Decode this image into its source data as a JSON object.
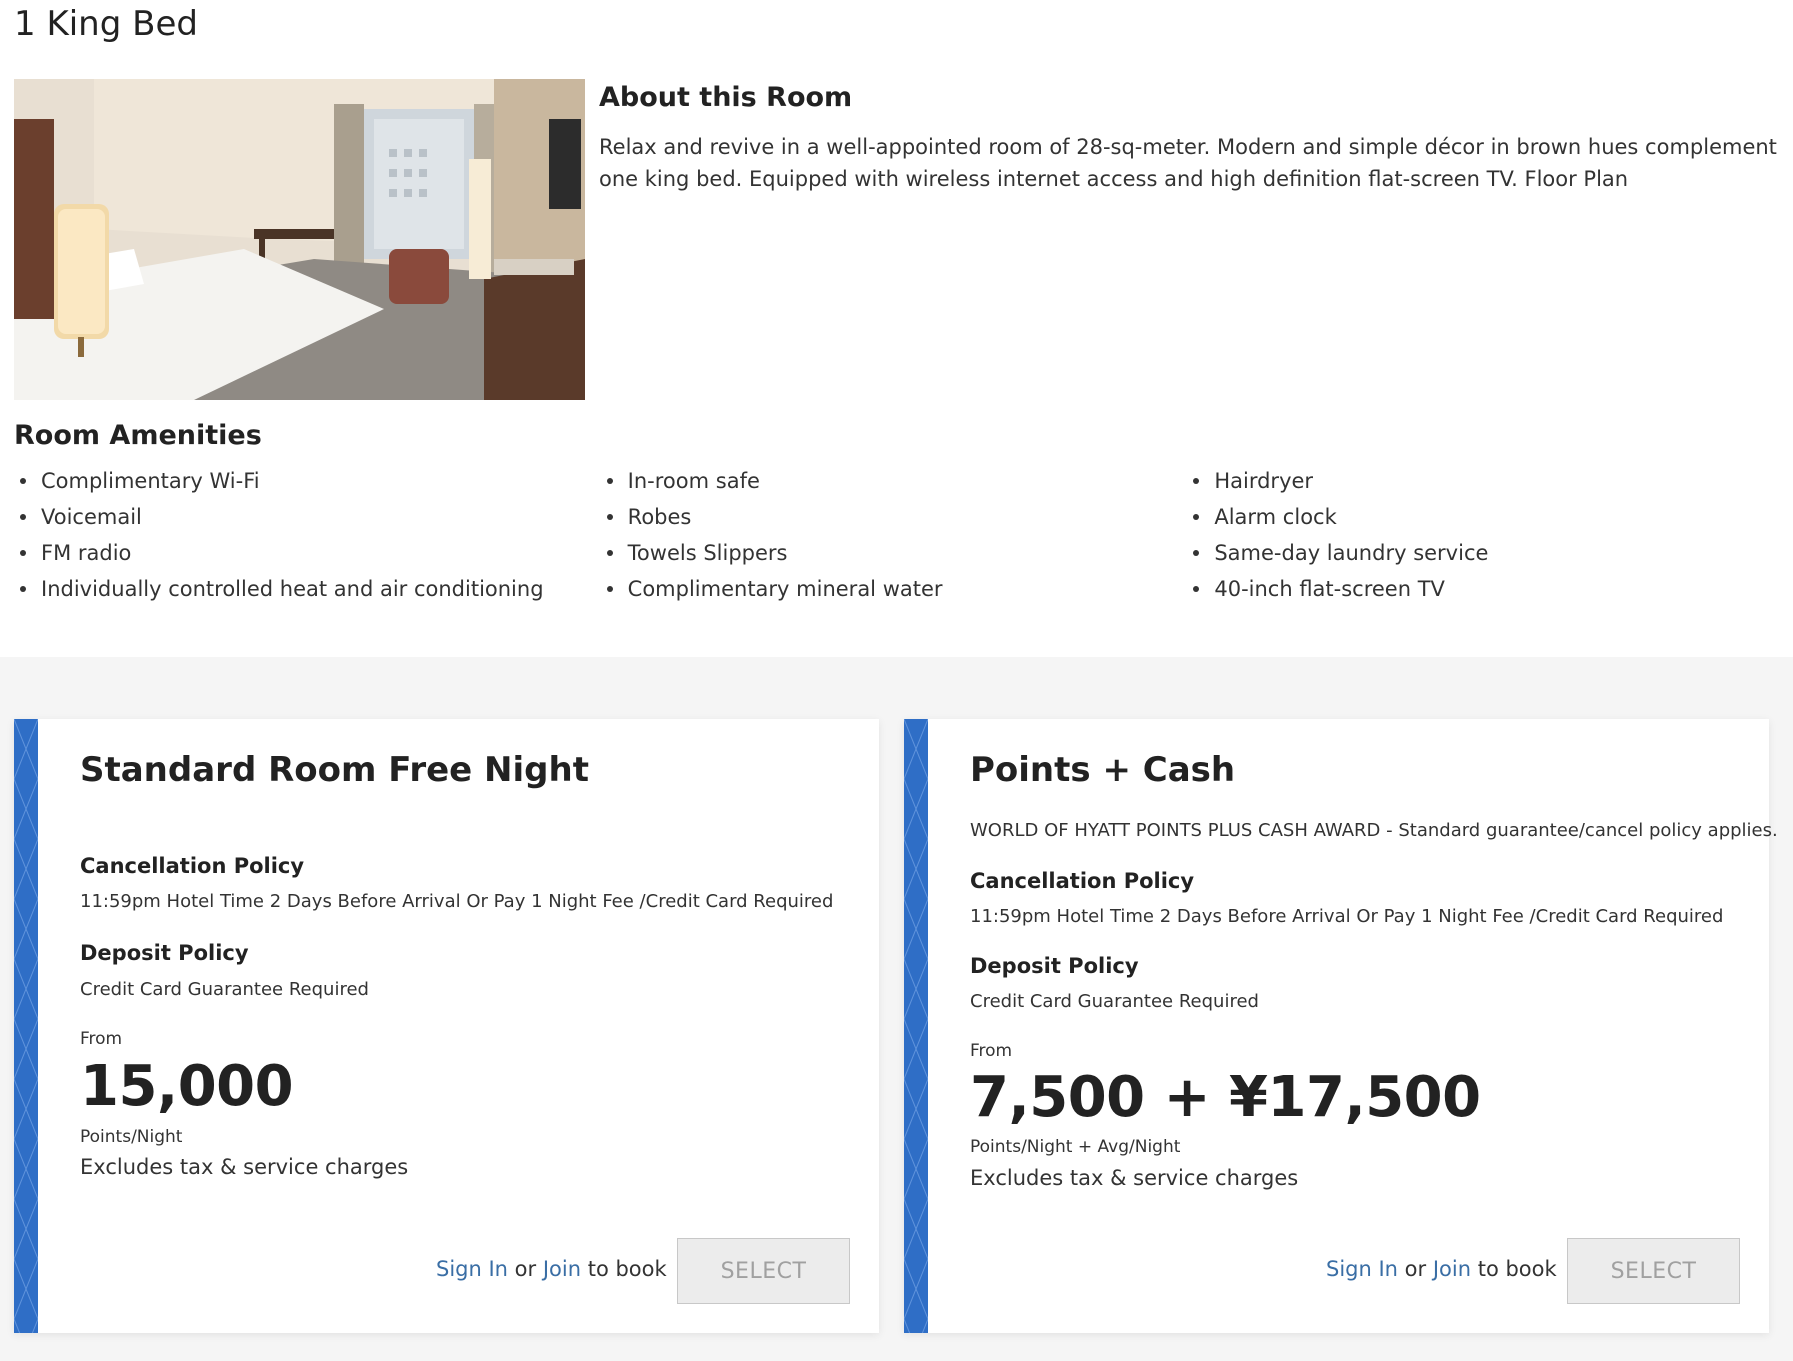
{
  "room": {
    "title": "1 King Bed"
  },
  "about": {
    "heading": "About this Room",
    "text": "Relax and revive in a well-appointed room of 28-sq-meter. Modern and simple décor in brown hues complement one king bed. Equipped with wireless internet access and high definition flat-screen TV. Floor Plan"
  },
  "amenities": {
    "heading": "Room Amenities",
    "columns": [
      [
        "Complimentary Wi-Fi",
        "Voicemail",
        "FM radio",
        "Individually controlled heat and air conditioning"
      ],
      [
        "In-room safe",
        "Robes",
        "Towels Slippers",
        "Complimentary mineral water"
      ],
      [
        "Hairdryer",
        "Alarm clock",
        "Same-day laundry service",
        "40-inch flat-screen TV"
      ]
    ]
  },
  "offers": [
    {
      "title": "Standard Room Free Night",
      "cancellation_heading": "Cancellation Policy",
      "cancellation_text": "11:59pm Hotel Time 2 Days Before Arrival Or Pay 1 Night Fee /Credit Card Required",
      "deposit_heading": "Deposit Policy",
      "deposit_text": "Credit Card Guarantee Required",
      "from_label": "From",
      "price": "15,000",
      "price_unit": "Points/Night",
      "excludes": "Excludes tax & service charges",
      "sign_in": "Sign In",
      "or": "or",
      "join": "Join",
      "to_book": "to book",
      "select_label": "SELECT"
    },
    {
      "title": "Points + Cash",
      "description": "WORLD OF HYATT POINTS PLUS CASH AWARD - Standard guarantee/cancel policy applies.",
      "cancellation_heading": "Cancellation Policy",
      "cancellation_text": "11:59pm Hotel Time 2 Days Before Arrival Or Pay 1 Night Fee /Credit Card Required",
      "deposit_heading": "Deposit Policy",
      "deposit_text": "Credit Card Guarantee Required",
      "from_label": "From",
      "price": "7,500 + ¥17,500",
      "price_unit": "Points/Night + Avg/Night",
      "excludes": "Excludes tax & service charges",
      "sign_in": "Sign In",
      "or": "or",
      "join": "Join",
      "to_book": "to book",
      "select_label": "SELECT"
    }
  ],
  "colors": {
    "accent_stripe": "#2f6ec6",
    "link": "#3a6ea5",
    "disabled_button": "#ececec"
  }
}
